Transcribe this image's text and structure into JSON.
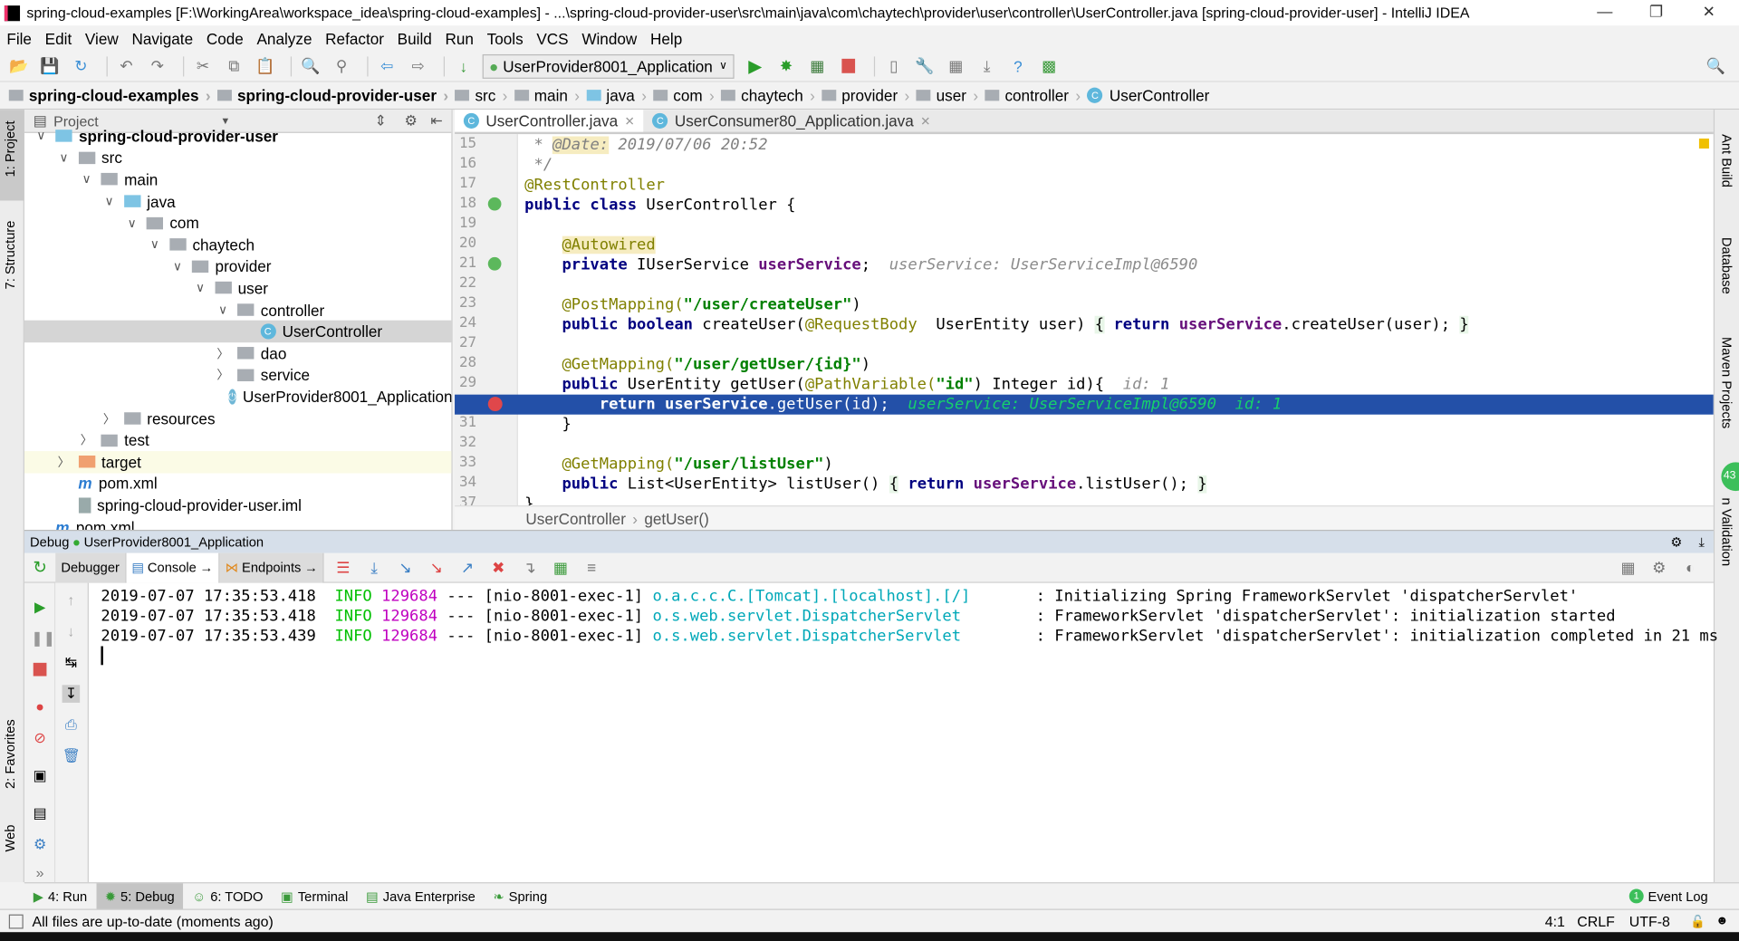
{
  "window": {
    "title": "spring-cloud-examples [F:\\WorkingArea\\workspace_idea\\spring-cloud-examples] - ...\\spring-cloud-provider-user\\src\\main\\java\\com\\chaytech\\provider\\user\\controller\\UserController.java [spring-cloud-provider-user] - IntelliJ IDEA"
  },
  "menu": [
    "File",
    "Edit",
    "View",
    "Navigate",
    "Code",
    "Analyze",
    "Refactor",
    "Build",
    "Run",
    "Tools",
    "VCS",
    "Window",
    "Help"
  ],
  "toolbar": {
    "run_config": "UserProvider8001_Application"
  },
  "breadcrumbs": [
    "spring-cloud-examples",
    "spring-cloud-provider-user",
    "src",
    "main",
    "java",
    "com",
    "chaytech",
    "provider",
    "user",
    "controller",
    "UserController"
  ],
  "left_stripe": {
    "project": "1: Project",
    "structure": "7: Structure",
    "favorites": "2: Favorites",
    "web": "Web"
  },
  "right_stripe": {
    "ant": "Ant Build",
    "database": "Database",
    "maven": "Maven Projects",
    "validation": "n Validation",
    "badge": "43"
  },
  "project": {
    "title": "Project",
    "tree": [
      {
        "label": "spring-cloud-provider-user",
        "depth": 0,
        "arrow": "down",
        "icon": "module",
        "bold": true
      },
      {
        "label": "src",
        "depth": 1,
        "arrow": "down",
        "icon": "folder"
      },
      {
        "label": "main",
        "depth": 2,
        "arrow": "down",
        "icon": "folder"
      },
      {
        "label": "java",
        "depth": 3,
        "arrow": "down",
        "icon": "folder-blue"
      },
      {
        "label": "com",
        "depth": 4,
        "arrow": "down",
        "icon": "package"
      },
      {
        "label": "chaytech",
        "depth": 5,
        "arrow": "down",
        "icon": "package"
      },
      {
        "label": "provider",
        "depth": 6,
        "arrow": "down",
        "icon": "package"
      },
      {
        "label": "user",
        "depth": 7,
        "arrow": "down",
        "icon": "package"
      },
      {
        "label": "controller",
        "depth": 8,
        "arrow": "down",
        "icon": "package"
      },
      {
        "label": "UserController",
        "depth": 9,
        "arrow": "",
        "icon": "class",
        "selected": true
      },
      {
        "label": "dao",
        "depth": 8,
        "arrow": "right",
        "icon": "package"
      },
      {
        "label": "service",
        "depth": 8,
        "arrow": "right",
        "icon": "package"
      },
      {
        "label": "UserProvider8001_Application",
        "depth": 8,
        "arrow": "",
        "icon": "spring-boot"
      },
      {
        "label": "resources",
        "depth": 3,
        "arrow": "right",
        "icon": "folder"
      },
      {
        "label": "test",
        "depth": 2,
        "arrow": "right",
        "icon": "folder"
      },
      {
        "label": "target",
        "depth": 1,
        "arrow": "right",
        "icon": "folder-orange",
        "highlight": true
      },
      {
        "label": "pom.xml",
        "depth": 1,
        "arrow": "",
        "icon": "maven"
      },
      {
        "label": "spring-cloud-provider-user.iml",
        "depth": 1,
        "arrow": "",
        "icon": "file"
      },
      {
        "label": "pom.xml",
        "depth": 0,
        "arrow": "",
        "icon": "maven"
      }
    ]
  },
  "editor": {
    "tabs": [
      {
        "label": "UserController.java",
        "active": true
      },
      {
        "label": "UserConsumer80_Application.java",
        "active": false
      }
    ],
    "lines": [
      {
        "n": "15",
        "tokens": [
          [
            " * ",
            "cm"
          ],
          [
            "@Date:",
            "cm anb"
          ],
          [
            " 2019/07/06 20:52",
            "cm"
          ]
        ]
      },
      {
        "n": "16",
        "tokens": [
          [
            " */",
            "cm"
          ]
        ]
      },
      {
        "n": "17",
        "tokens": [
          [
            "@RestController",
            "an"
          ]
        ]
      },
      {
        "n": "18",
        "tokens": [
          [
            "public class ",
            "kw"
          ],
          [
            "UserController {",
            ""
          ]
        ]
      },
      {
        "n": "19",
        "tokens": []
      },
      {
        "n": "20",
        "tokens": [
          [
            "    ",
            ""
          ],
          [
            "@Autowired",
            "anb"
          ]
        ]
      },
      {
        "n": "21",
        "tokens": [
          [
            "    private ",
            "kw"
          ],
          [
            "IUserService ",
            ""
          ],
          [
            "userService",
            "fd"
          ],
          [
            ";  ",
            ""
          ],
          [
            "userService: UserServiceImpl@6590",
            "hint"
          ]
        ]
      },
      {
        "n": "22",
        "tokens": []
      },
      {
        "n": "23",
        "tokens": [
          [
            "    @PostMapping(",
            "an"
          ],
          [
            "\"/user/createUser\"",
            "st"
          ],
          [
            ")",
            ""
          ]
        ]
      },
      {
        "n": "24",
        "tokens": [
          [
            "    public boolean ",
            "kw"
          ],
          [
            "createUser(",
            ""
          ],
          [
            "@RequestBody",
            "an"
          ],
          [
            "  UserEntity user) ",
            ""
          ],
          [
            "{",
            "br"
          ],
          [
            " return ",
            "kw"
          ],
          [
            "userService",
            "fd"
          ],
          [
            ".createUser(user); ",
            ""
          ],
          [
            "}",
            "br"
          ]
        ]
      },
      {
        "n": "27",
        "tokens": []
      },
      {
        "n": "28",
        "tokens": [
          [
            "    @GetMapping(",
            "an"
          ],
          [
            "\"/user/getUser/{id}\"",
            "st"
          ],
          [
            ")",
            ""
          ]
        ]
      },
      {
        "n": "29",
        "tokens": [
          [
            "    public ",
            "kw"
          ],
          [
            "UserEntity getUser(",
            ""
          ],
          [
            "@PathVariable(",
            "an"
          ],
          [
            "\"id\"",
            "st"
          ],
          [
            ") Integer id){  ",
            ""
          ],
          [
            "id: 1",
            "hint"
          ]
        ]
      },
      {
        "n": "30",
        "tokens": [
          [
            "        return ",
            "kw"
          ],
          [
            "userService",
            "fd"
          ],
          [
            ".getUser(id);  ",
            ""
          ],
          [
            "userService: UserServiceImpl@6590  id: 1",
            "hint"
          ]
        ],
        "current": true
      },
      {
        "n": "31",
        "tokens": [
          [
            "    }",
            ""
          ]
        ]
      },
      {
        "n": "32",
        "tokens": []
      },
      {
        "n": "33",
        "tokens": [
          [
            "    @GetMapping(",
            "an"
          ],
          [
            "\"/user/listUser\"",
            "st"
          ],
          [
            ")",
            ""
          ]
        ]
      },
      {
        "n": "34",
        "tokens": [
          [
            "    public ",
            "kw"
          ],
          [
            "List<UserEntity> listUser() ",
            ""
          ],
          [
            "{",
            "br"
          ],
          [
            " return ",
            "kw"
          ],
          [
            "userService",
            "fd"
          ],
          [
            ".listUser(); ",
            ""
          ],
          [
            "}",
            "br"
          ]
        ]
      },
      {
        "n": "37",
        "tokens": [
          [
            "}",
            ""
          ]
        ]
      }
    ],
    "breadcrumb": [
      "UserController",
      "getUser()"
    ]
  },
  "debug": {
    "label": "Debug",
    "config": "UserProvider8001_Application",
    "tabs": [
      "Debugger",
      "Console",
      "Endpoints"
    ],
    "log": [
      {
        "ts": "2019-07-07 17:35:53.418",
        "level": "INFO",
        "pid": "129684",
        "sep": "---",
        "thread": "[nio-8001-exec-1]",
        "logger": "o.a.c.c.C.[Tomcat].[localhost].[/]      ",
        "msg": ": Initializing Spring FrameworkServlet 'dispatcherServlet'"
      },
      {
        "ts": "2019-07-07 17:35:53.418",
        "level": "INFO",
        "pid": "129684",
        "sep": "---",
        "thread": "[nio-8001-exec-1]",
        "logger": "o.s.web.servlet.DispatcherServlet       ",
        "msg": ": FrameworkServlet 'dispatcherServlet': initialization started"
      },
      {
        "ts": "2019-07-07 17:35:53.439",
        "level": "INFO",
        "pid": "129684",
        "sep": "---",
        "thread": "[nio-8001-exec-1]",
        "logger": "o.s.web.servlet.DispatcherServlet       ",
        "msg": ": FrameworkServlet 'dispatcherServlet': initialization completed in 21 ms"
      }
    ]
  },
  "tool_windows": [
    {
      "label": "4: Run",
      "icon": "run-icon"
    },
    {
      "label": "5: Debug",
      "icon": "debug-icon",
      "active": true
    },
    {
      "label": "6: TODO",
      "icon": "todo-icon"
    },
    {
      "label": "Terminal",
      "icon": "terminal-icon"
    },
    {
      "label": "Java Enterprise",
      "icon": "java-ee-icon"
    },
    {
      "label": "Spring",
      "icon": "spring-icon"
    }
  ],
  "event_log": {
    "label": "Event Log",
    "count": "1"
  },
  "status": {
    "message": "All files are up-to-date (moments ago)",
    "position": "4:1",
    "line_sep": "CRLF",
    "encoding": "UTF-8"
  },
  "colors": {
    "current_line": "#2350a8",
    "breakpoint": "#e0474b",
    "debug_header": "#d6dfea"
  }
}
